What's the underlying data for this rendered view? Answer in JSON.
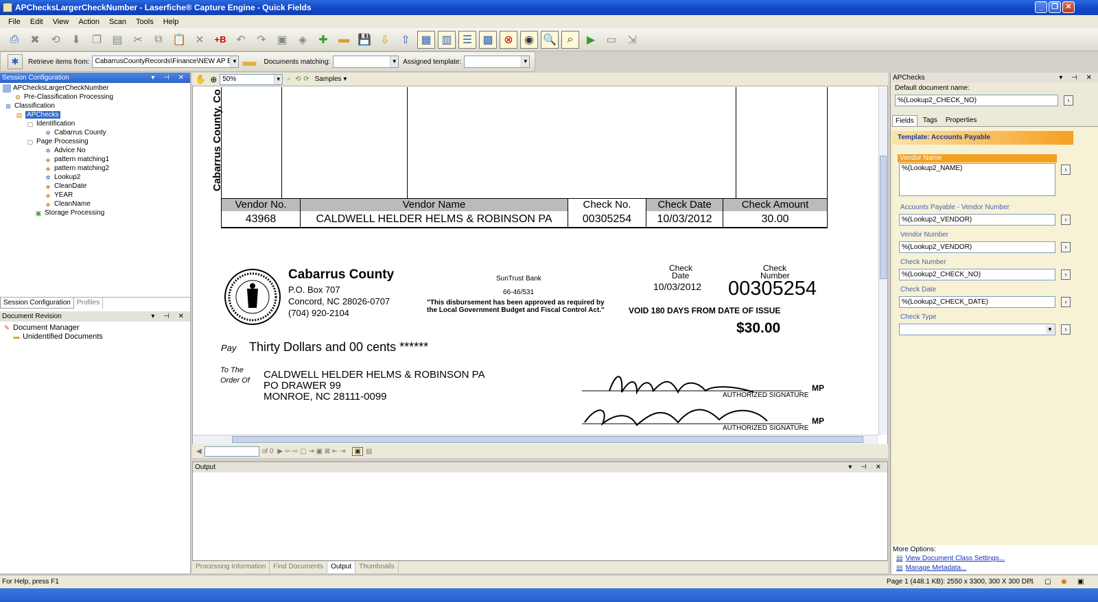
{
  "window": {
    "title": "APChecksLargerCheckNumber - Laserfiche® Capture Engine - Quick Fields",
    "buttons": [
      "_",
      "❐",
      "✕"
    ]
  },
  "menu": [
    "File",
    "Edit",
    "View",
    "Action",
    "Scan",
    "Tools",
    "Help"
  ],
  "toolbar2": {
    "retrieve_label": "Retrieve items from:",
    "retrieve_value": "CabarrusCountyRecords\\Finance\\NEW AP Batche",
    "docs_matching_label": "Documents matching:",
    "docs_matching_value": "",
    "assigned_template_label": "Assigned template:",
    "assigned_template_value": ""
  },
  "session_panel": {
    "title": "Session Configuration",
    "tree": {
      "root": "APChecksLargerCheckNumber",
      "preclass": "Pre-Classification Processing",
      "classification": "Classification",
      "apchecks": "APChecks",
      "identification": "Identification",
      "cabarrus": "Cabarrus County",
      "page_processing": "Page Processing",
      "advice_no": "Advice No",
      "pm1": "pattern matching1",
      "pm2": "pattern matching2",
      "lookup2": "Lookup2",
      "cleandate": "CleanDate",
      "year": "YEAR",
      "cleanname": "CleanName",
      "storage": "Storage Processing"
    },
    "tabs": [
      "Session Configuration",
      "Profiles"
    ]
  },
  "revision_panel": {
    "title": "Document Revision",
    "items": [
      "Document Manager",
      "Unidentified Documents"
    ]
  },
  "viewer": {
    "zoom": "50%",
    "samples": "Samples",
    "page_of": "of 0"
  },
  "check": {
    "vertical_text": "Cabarrus County, Co",
    "headers": [
      "Vendor No.",
      "Vendor Name",
      "Check No.",
      "Check Date",
      "Check Amount"
    ],
    "values": [
      "43968",
      "CALDWELL HELDER HELMS & ROBINSON PA",
      "00305254",
      "10/03/2012",
      "30.00"
    ],
    "org_name": "Cabarrus County",
    "org_addr1": "P.O. Box 707",
    "org_addr2": "Concord, NC 28026-0707",
    "org_phone": "(704) 920-2104",
    "bank": "SunTrust Bank",
    "routing": "66-46/531",
    "disclaimer1": "\"This disbursement has been approved as required by",
    "disclaimer2": "the Local Government Budget and Fiscal Control Act.\"",
    "check_date_label1": "Check",
    "check_date_label2": "Date",
    "check_date": "10/03/2012",
    "check_num_label1": "Check",
    "check_num_label2": "Number",
    "check_number": "00305254",
    "void_text": "VOID 180 DAYS FROM DATE OF ISSUE",
    "amount": "$30.00",
    "pay_label": "Pay",
    "pay_words": "Thirty Dollars and 00 cents ******",
    "order_label1": "To The",
    "order_label2": "Order Of",
    "payee1": "CALDWELL HELDER HELMS & ROBINSON PA",
    "payee2": "PO DRAWER 99",
    "payee3": "MONROE, NC 28111-0099",
    "sig_label": "AUTHORIZED SIGNATURE",
    "mp": "MP"
  },
  "output_panel": {
    "title": "Output"
  },
  "bottom_tabs": [
    "Processing Information",
    "Find Documents",
    "Output",
    "Thumbnails"
  ],
  "right_panel": {
    "title": "APChecks",
    "default_doc_label": "Default document name:",
    "default_doc_value": "%(Lookup2_CHECK_NO)",
    "tabs": [
      "Fields",
      "Tags",
      "Properties"
    ],
    "template": "Template: Accounts Payable",
    "fields": [
      {
        "label": "Vendor Name",
        "value": "%(Lookup2_NAME)"
      },
      {
        "label": "Accounts Payable - Vendor Number",
        "value": "%(Lookup2_VENDOR)"
      },
      {
        "label": "Vendor Number",
        "value": "%(Lookup2_VENDOR)"
      },
      {
        "label": "Check Number",
        "value": "%(Lookup2_CHECK_NO)"
      },
      {
        "label": "Check Date",
        "value": "%(Lookup2_CHECK_DATE)"
      },
      {
        "label": "Check Type",
        "value": ""
      }
    ],
    "more_options": "More Options:",
    "link1": "View Document Class Settings...",
    "link2": "Manage Metadata..."
  },
  "status": {
    "left": "For Help, press F1",
    "right": "Page 1 (448.1 KB): 2550 x 3300, 300 X 300 DPI"
  },
  "colors": {
    "title_blue": "#1448c8",
    "template_orange": "#f4a020",
    "panel_bg": "#ece9d8"
  }
}
